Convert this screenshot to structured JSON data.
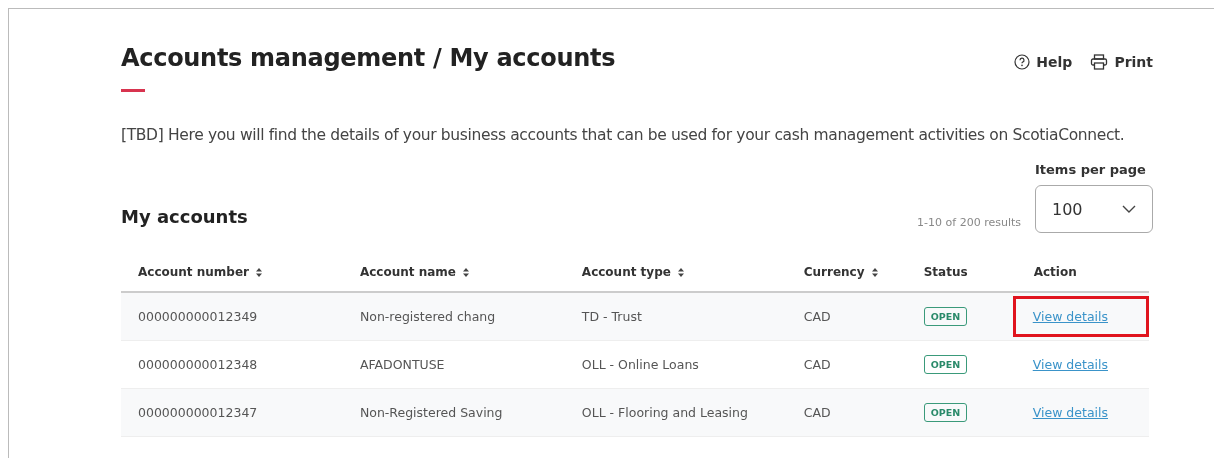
{
  "header": {
    "title": "Accounts management / My accounts",
    "actions": [
      {
        "kind": "help",
        "label": "Help"
      },
      {
        "kind": "print",
        "label": "Print"
      }
    ]
  },
  "description": "[TBD] Here you will find the details of your business accounts that can be used for your cash management activities on ScotiaConnect.",
  "section_title": "My accounts",
  "results": "1-10 of 200 results",
  "items_per_page": {
    "label": "Items per page",
    "value": "100"
  },
  "table": {
    "columns": [
      {
        "label": "Account number",
        "sortable": true
      },
      {
        "label": "Account name",
        "sortable": true
      },
      {
        "label": "Account type",
        "sortable": true
      },
      {
        "label": "Currency",
        "sortable": true
      },
      {
        "label": "Status",
        "sortable": false
      },
      {
        "label": "Action",
        "sortable": false
      }
    ],
    "rows": [
      {
        "cells": [
          "000000000012349",
          "Non-registered chang",
          "TD - Trust",
          "CAD"
        ],
        "status": "OPEN",
        "action": "View details",
        "highlighted": true
      },
      {
        "cells": [
          "000000000012348",
          "AFADONTUSE",
          "OLL - Online Loans",
          "CAD"
        ],
        "status": "OPEN",
        "action": "View details",
        "highlighted": false
      },
      {
        "cells": [
          "000000000012347",
          "Non-Registered Saving",
          "OLL - Flooring and Leasing",
          "CAD"
        ],
        "status": "OPEN",
        "action": "View details",
        "highlighted": false
      }
    ]
  }
}
